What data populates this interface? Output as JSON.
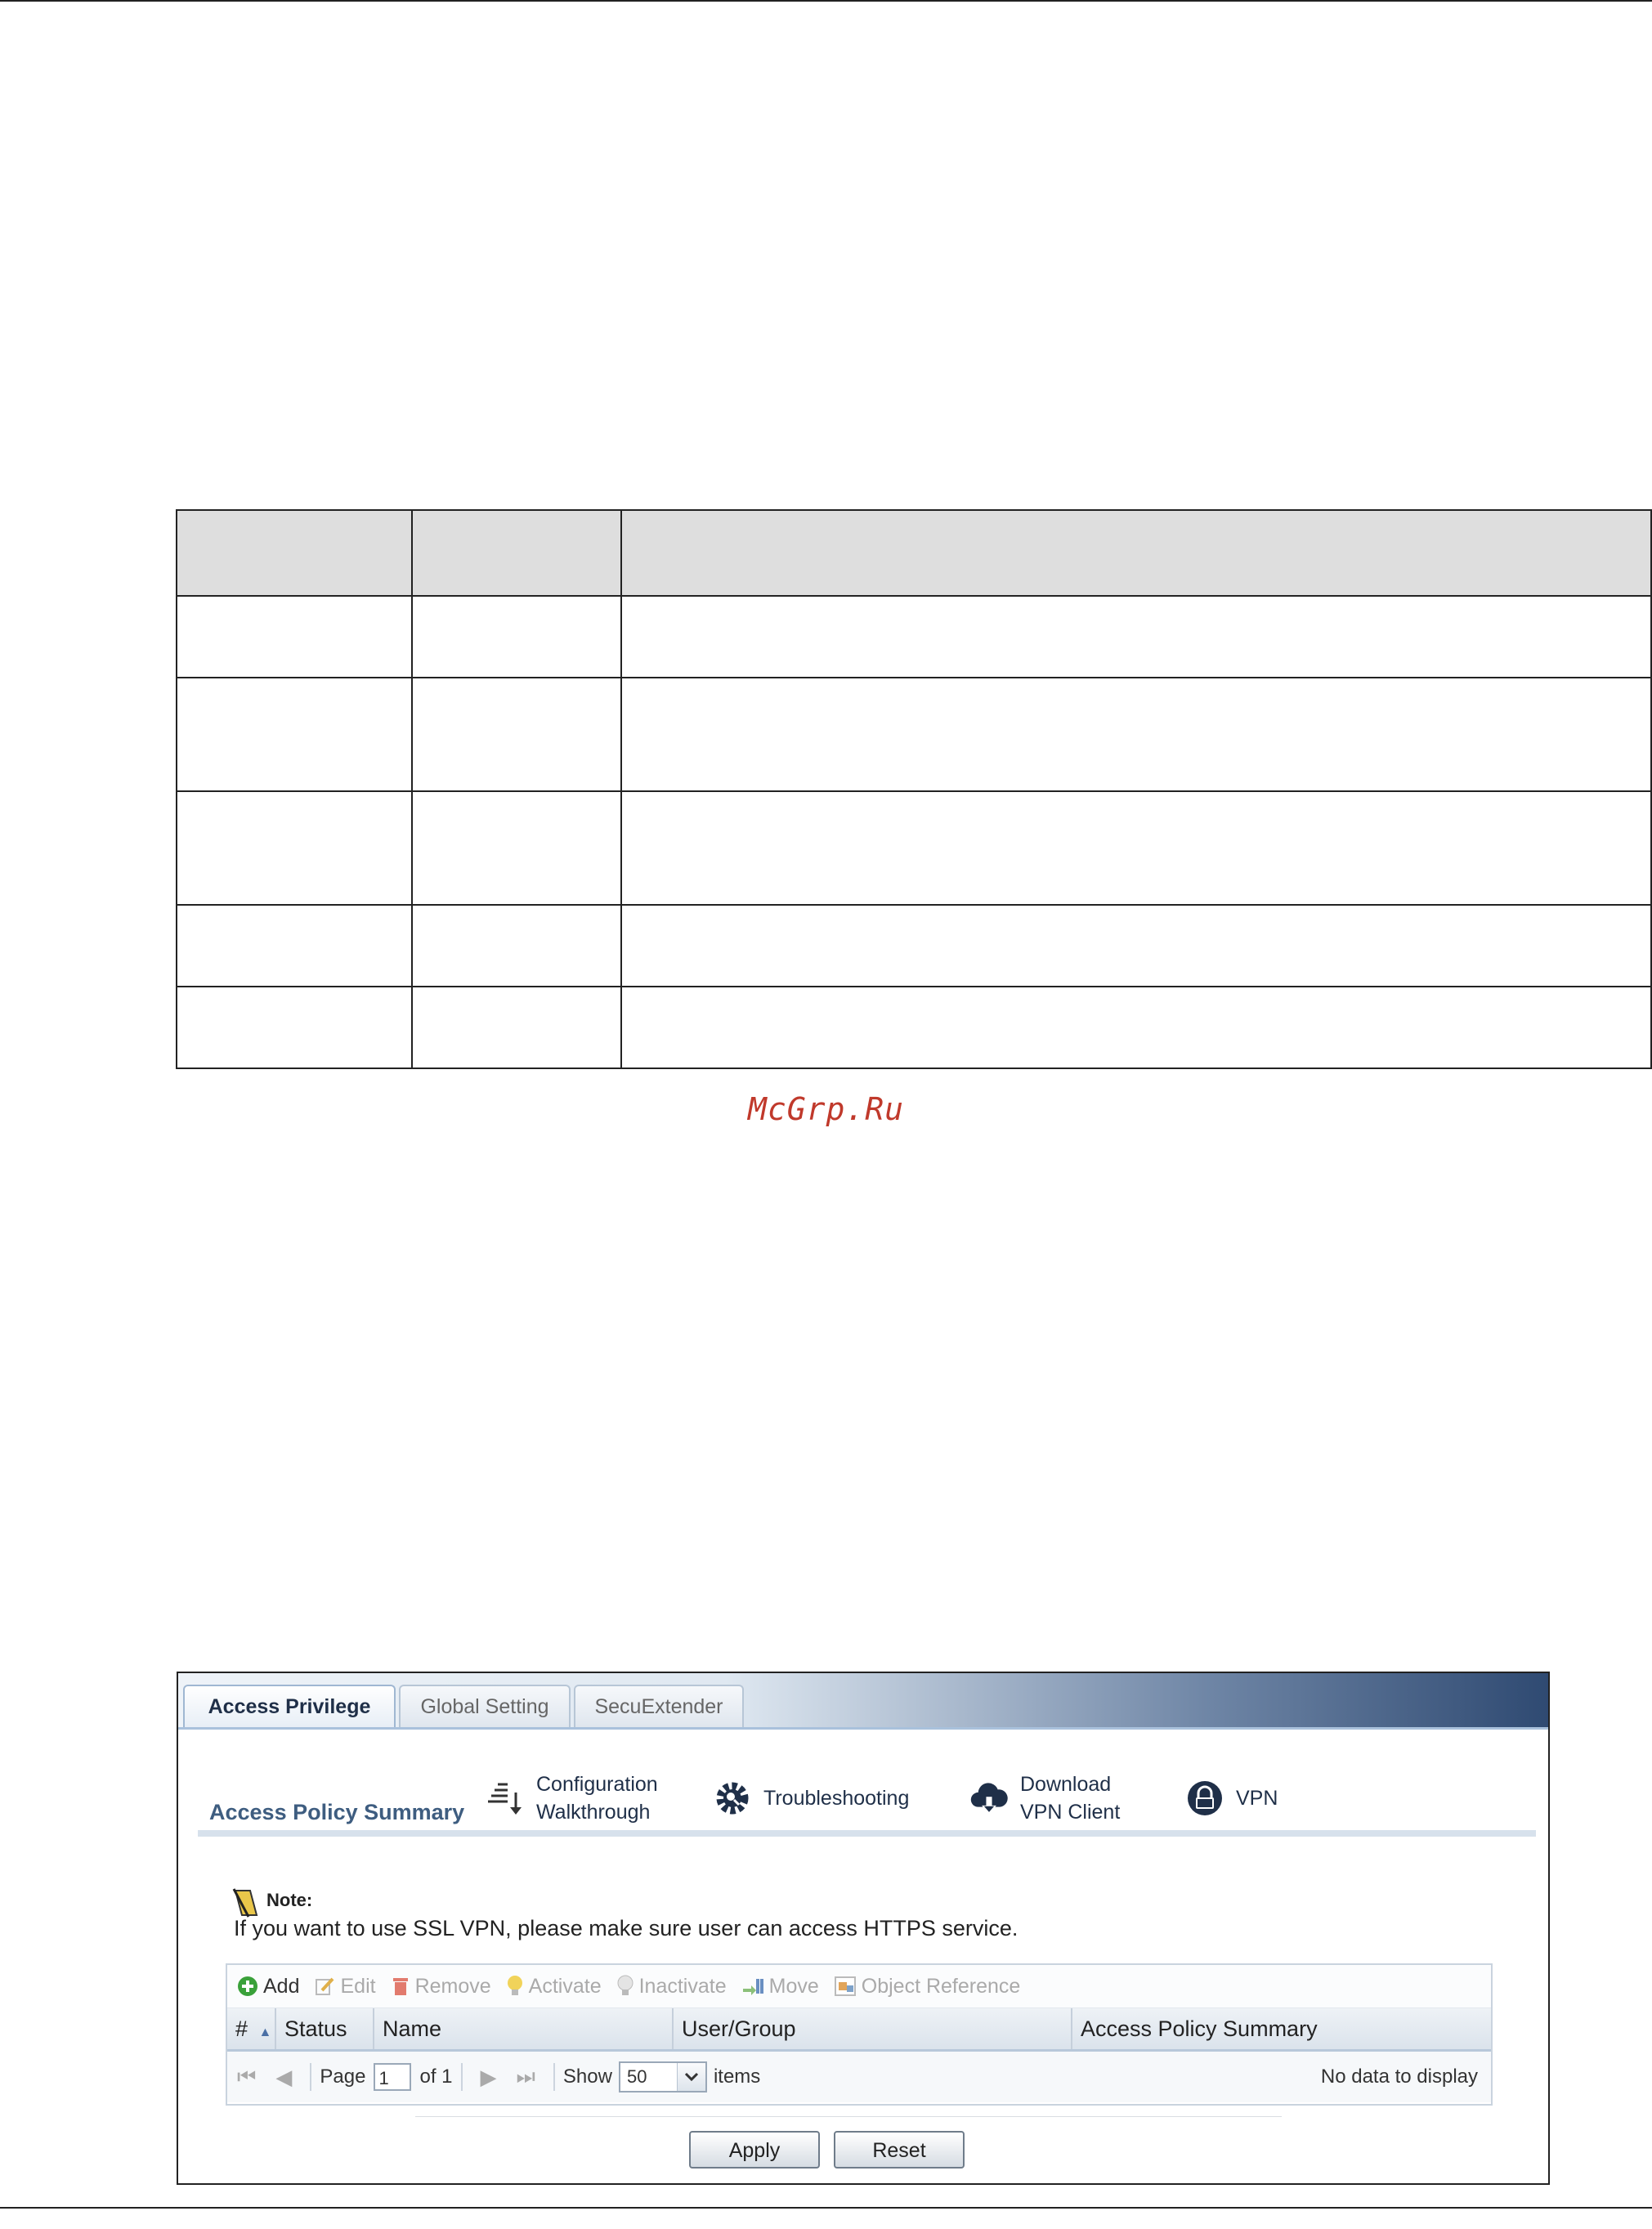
{
  "watermark": "McGrp.Ru",
  "tabs": [
    {
      "label": "Access Privilege",
      "active": true
    },
    {
      "label": "Global Setting",
      "active": false
    },
    {
      "label": "SecuExtender",
      "active": false
    }
  ],
  "section_title": "Access Policy Summary",
  "quick_links": {
    "configuration": {
      "line1": "Configuration",
      "line2": "Walkthrough",
      "icon": "configuration-walkthrough-icon"
    },
    "troubleshooting": {
      "line1": "Troubleshooting",
      "icon": "troubleshooting-gear-icon"
    },
    "download": {
      "line1": "Download",
      "line2": "VPN Client",
      "icon": "cloud-download-icon"
    },
    "vpn": {
      "line1": "VPN",
      "icon": "vpn-lock-icon"
    }
  },
  "note": {
    "label": "Note:",
    "text": "If you want to use SSL VPN, please make sure user can access HTTPS service."
  },
  "toolbar": {
    "add": "Add",
    "edit": "Edit",
    "remove": "Remove",
    "activate": "Activate",
    "inactivate": "Inactivate",
    "move": "Move",
    "object_reference": "Object Reference"
  },
  "columns": {
    "index": "#",
    "status": "Status",
    "name": "Name",
    "user_group": "User/Group",
    "summary": "Access Policy Summary"
  },
  "pager": {
    "page_label": "Page",
    "page_value": "1",
    "of_label": "of 1",
    "show_label": "Show",
    "show_value": "50",
    "items_label": "items",
    "no_data": "No data to display"
  },
  "buttons": {
    "apply": "Apply",
    "reset": "Reset"
  },
  "colors": {
    "tab_text": "#1f2f48",
    "section_title": "#3e5d80",
    "watermark": "#c0392b",
    "add_icon": "#3aa13a"
  }
}
